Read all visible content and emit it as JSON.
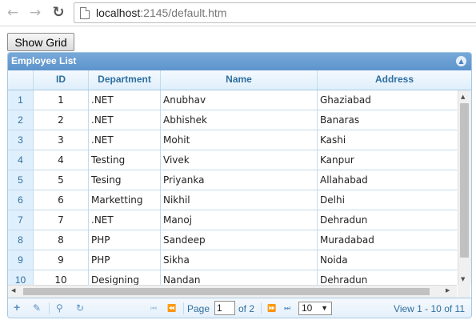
{
  "browser": {
    "url_host": "localhost",
    "url_path": ":2145/default.htm"
  },
  "show_grid_label": "Show Grid",
  "grid": {
    "caption": "Employee List",
    "columns": [
      "ID",
      "Department",
      "Name",
      "Address"
    ],
    "rows": [
      {
        "rn": "1",
        "id": "1",
        "department": ".NET",
        "name": "Anubhav",
        "address": "Ghaziabad"
      },
      {
        "rn": "2",
        "id": "2",
        "department": ".NET",
        "name": "Abhishek",
        "address": "Banaras"
      },
      {
        "rn": "3",
        "id": "3",
        "department": ".NET",
        "name": "Mohit",
        "address": "Kashi"
      },
      {
        "rn": "4",
        "id": "4",
        "department": "Testing",
        "name": "Vivek",
        "address": "Kanpur"
      },
      {
        "rn": "5",
        "id": "5",
        "department": "Tesing",
        "name": "Priyanka",
        "address": "Allahabad"
      },
      {
        "rn": "6",
        "id": "6",
        "department": "Marketting",
        "name": "Nikhil",
        "address": "Delhi"
      },
      {
        "rn": "7",
        "id": "7",
        "department": ".NET",
        "name": "Manoj",
        "address": "Dehradun"
      },
      {
        "rn": "8",
        "id": "8",
        "department": "PHP",
        "name": "Sandeep",
        "address": "Muradabad"
      },
      {
        "rn": "9",
        "id": "9",
        "department": "PHP",
        "name": "Sikha",
        "address": "Noida"
      },
      {
        "rn": "10",
        "id": "10",
        "department": "Designing",
        "name": "Nandan",
        "address": "Dehradun"
      }
    ]
  },
  "pager": {
    "page_label": "Page",
    "page_value": "1",
    "of_label": "of 2",
    "rows_per_page": "10",
    "view_text": "View 1 - 10 of 11"
  }
}
